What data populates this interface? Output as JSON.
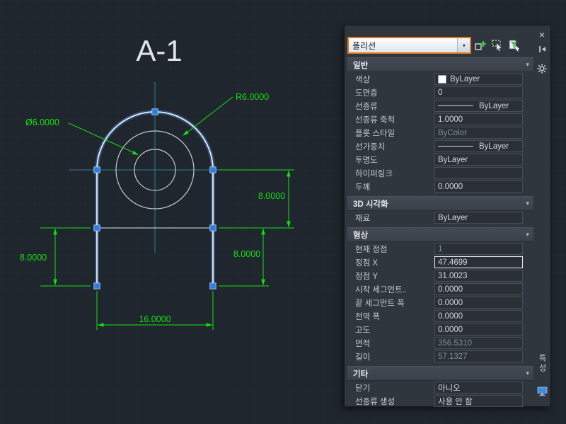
{
  "canvas": {
    "title": "A-1",
    "labels": {
      "radius": "R6.0000",
      "diameter": "Ø6.0000",
      "dim_right_upper": "8.0000",
      "dim_right_lower": "8.0000",
      "dim_left": "8.0000",
      "dim_bottom": "16.0000"
    },
    "colors": {
      "dimension_green": "#16de16",
      "centerline_teal": "#2f7b8c",
      "grip_blue": "#2e7de2",
      "selection_highlight_orange": "#e0781e"
    }
  },
  "palette": {
    "selector_value": "폴리선",
    "side_title": "특성",
    "icons": {
      "close": "×",
      "chevron": "▾",
      "combo_arrow": "▼"
    },
    "general": {
      "title": "일반",
      "color": {
        "label": "색상",
        "value": "ByLayer"
      },
      "layer": {
        "label": "도면층",
        "value": "0"
      },
      "linetype": {
        "label": "선종류",
        "value": "ByLayer"
      },
      "linetype_scale": {
        "label": "선종류 축척",
        "value": "1.0000"
      },
      "plot_style": {
        "label": "플롯 스타일",
        "value": "ByColor"
      },
      "lineweight": {
        "label": "선가중치",
        "value": "ByLayer"
      },
      "transparency": {
        "label": "투명도",
        "value": "ByLayer"
      },
      "hyperlink": {
        "label": "하이퍼링크",
        "value": ""
      },
      "thickness": {
        "label": "두께",
        "value": "0.0000"
      }
    },
    "visualization": {
      "title": "3D 시각화",
      "material": {
        "label": "재료",
        "value": "ByLayer"
      }
    },
    "geometry": {
      "title": "형상",
      "current_vertex": {
        "label": "현재 정점",
        "value": "1"
      },
      "vertex_x": {
        "label": "정점 X",
        "value": "47.4699"
      },
      "vertex_y": {
        "label": "정점 Y",
        "value": "31.0023"
      },
      "start_segment_width": {
        "label": "시작 세그먼트..",
        "value": "0.0000"
      },
      "end_segment_width": {
        "label": "끝 세그먼트 폭",
        "value": "0.0000"
      },
      "global_width": {
        "label": "전역 폭",
        "value": "0.0000"
      },
      "elevation": {
        "label": "고도",
        "value": "0.0000"
      },
      "area": {
        "label": "면적",
        "value": "356.5310"
      },
      "length": {
        "label": "길이",
        "value": "57.1327"
      }
    },
    "misc": {
      "title": "기타",
      "closed": {
        "label": "닫기",
        "value": "아니오"
      },
      "linetype_gen": {
        "label": "선종류 생성",
        "value": "사용 안 함"
      }
    }
  }
}
